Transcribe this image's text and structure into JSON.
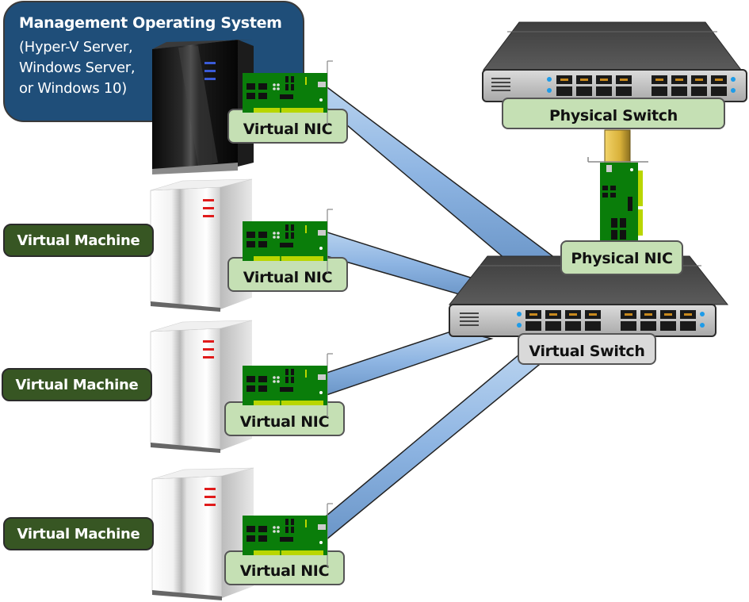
{
  "diagram": {
    "management_os": {
      "title": "Management Operating System",
      "subtitle_lines": [
        "(Hyper-V Server,",
        "Windows Server,",
        "or Windows 10)"
      ]
    },
    "virtual_machines": [
      {
        "label": "Virtual Machine",
        "nic_label": "Virtual NIC"
      },
      {
        "label": "Virtual Machine",
        "nic_label": "Virtual NIC"
      },
      {
        "label": "Virtual Machine",
        "nic_label": "Virtual NIC"
      }
    ],
    "management_nic_label": "Virtual NIC",
    "physical_switch_label": "Physical Switch",
    "physical_nic_label": "Physical NIC",
    "virtual_switch_label": "Virtual Switch",
    "colors": {
      "management_box": "#1f4e79",
      "vm_label": "#375623",
      "nic_label": "#c5e0b4",
      "virtual_switch_label": "#d9d9d9",
      "cable": "#8db4e2",
      "uplink_cable": "#e8c04a",
      "nic_board": "#0a7d0a",
      "vm_led": "#e01b1b",
      "host_led": "#3a5bd9"
    }
  }
}
